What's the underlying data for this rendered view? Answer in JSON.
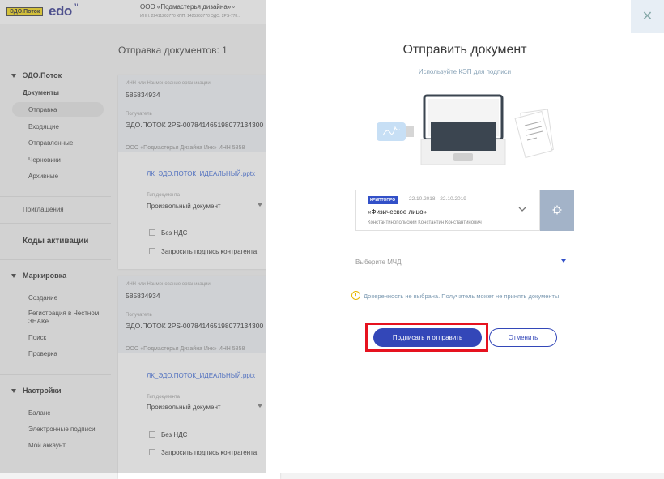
{
  "header": {
    "badge": "ЭДО.Поток",
    "logo": "edo",
    "logo_suffix": ".ru",
    "org": "ООО «Подмастерья дизайна»",
    "org_meta": "ИНН: 22411263770   КПП: 1425263770   ЭДО: 2PS-778..."
  },
  "sidebar": {
    "edo_section": "ЭДО.Поток",
    "documents": "Документы",
    "items": [
      "Отправка",
      "Входящие",
      "Отправленные",
      "Черновики",
      "Архивные"
    ],
    "invites": "Приглашения",
    "activation": "Коды активации",
    "marking": "Маркировка",
    "marking_items": [
      "Создание",
      "Регистрация в Честном ЗНАКе",
      "Поиск",
      "Проверка"
    ],
    "settings": "Настройки",
    "settings_items": [
      "Баланс",
      "Электронные подписи",
      "Мой аккаунт"
    ]
  },
  "main": {
    "title": "Отправка документов: 1",
    "cards": [
      {
        "inn_label": "ИНН или Наименование организации",
        "inn": "585834934",
        "recipient_label": "Получатель",
        "recipient": "ЭДО.ПОТОК 2PS-007841465198077134300",
        "org": "ООО «Подмастерья Дизайна Инк»   ИНН 5858",
        "file": "ЛК_ЭДО.ПОТОК_ИДЕАЛЬНЫЙ.pptx",
        "doctype_label": "Тип документа",
        "doctype": "Произвольный документ",
        "vat": "Без НДС",
        "sig": "Запросить подпись контрагента"
      },
      {
        "inn_label": "ИНН или Наименование организации",
        "inn": "585834934",
        "recipient_label": "Получатель",
        "recipient": "ЭДО.ПОТОК 2PS-007841465198077134300",
        "org": "ООО «Подмастерья Дизайна Инк»   ИНН 5858",
        "file": "ЛК_ЭДО.ПОТОК_ИДЕАЛЬНЫЙ.pptx",
        "doctype_label": "Тип документа",
        "doctype": "Произвольный документ",
        "vat": "Без НДС",
        "sig": "Запросить подпись контрагента"
      }
    ]
  },
  "modal": {
    "close": "✕",
    "title": "Отправить документ",
    "subtitle": "Используйте КЭП для подписи",
    "cert_badge": "КРИПТОПРО",
    "cert_dates": "22.10.2018 - 22.10.2019",
    "cert_type": "«Физическое лицо»",
    "cert_owner": "Константинопольский Константин Константинович",
    "mchd_placeholder": "Выберите МЧД",
    "warning": "Доверенность не выбрана. Получатель может не принять документы.",
    "sign_button": "Подписать и отправить",
    "cancel_button": "Отменить",
    "colors": {
      "primary": "#3347b8",
      "highlight": "#e6121f",
      "warning": "#e6b800"
    }
  }
}
